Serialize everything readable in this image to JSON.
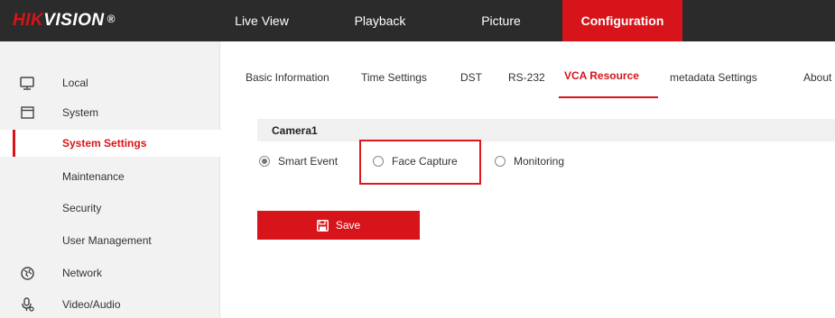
{
  "brand": {
    "name_red": "HIK",
    "name_white": "VISION",
    "reg": "®"
  },
  "nav": [
    {
      "label": "Live View"
    },
    {
      "label": "Playback"
    },
    {
      "label": "Picture"
    },
    {
      "label": "Configuration"
    }
  ],
  "sidebar": {
    "items": [
      {
        "label": "Local",
        "icon": "monitor-icon"
      },
      {
        "label": "System",
        "icon": "window-icon"
      },
      {
        "label": "System Settings"
      },
      {
        "label": "Maintenance"
      },
      {
        "label": "Security"
      },
      {
        "label": "User Management"
      },
      {
        "label": "Network",
        "icon": "globe-icon"
      },
      {
        "label": "Video/Audio",
        "icon": "microphone-icon"
      }
    ]
  },
  "tabs": [
    {
      "label": "Basic Information"
    },
    {
      "label": "Time Settings"
    },
    {
      "label": "DST"
    },
    {
      "label": "RS-232"
    },
    {
      "label": "VCA Resource"
    },
    {
      "label": "metadata Settings"
    },
    {
      "label": "About"
    }
  ],
  "section": {
    "title": "Camera1"
  },
  "options": [
    {
      "label": "Smart Event",
      "checked": true
    },
    {
      "label": "Face Capture",
      "checked": false
    },
    {
      "label": "Monitoring",
      "checked": false
    }
  ],
  "save": {
    "label": "Save",
    "icon": "floppy-disk-icon"
  },
  "colors": {
    "accent": "#d7141a",
    "topbar": "#2b2b2b",
    "sidebar": "#f2f2f2"
  }
}
